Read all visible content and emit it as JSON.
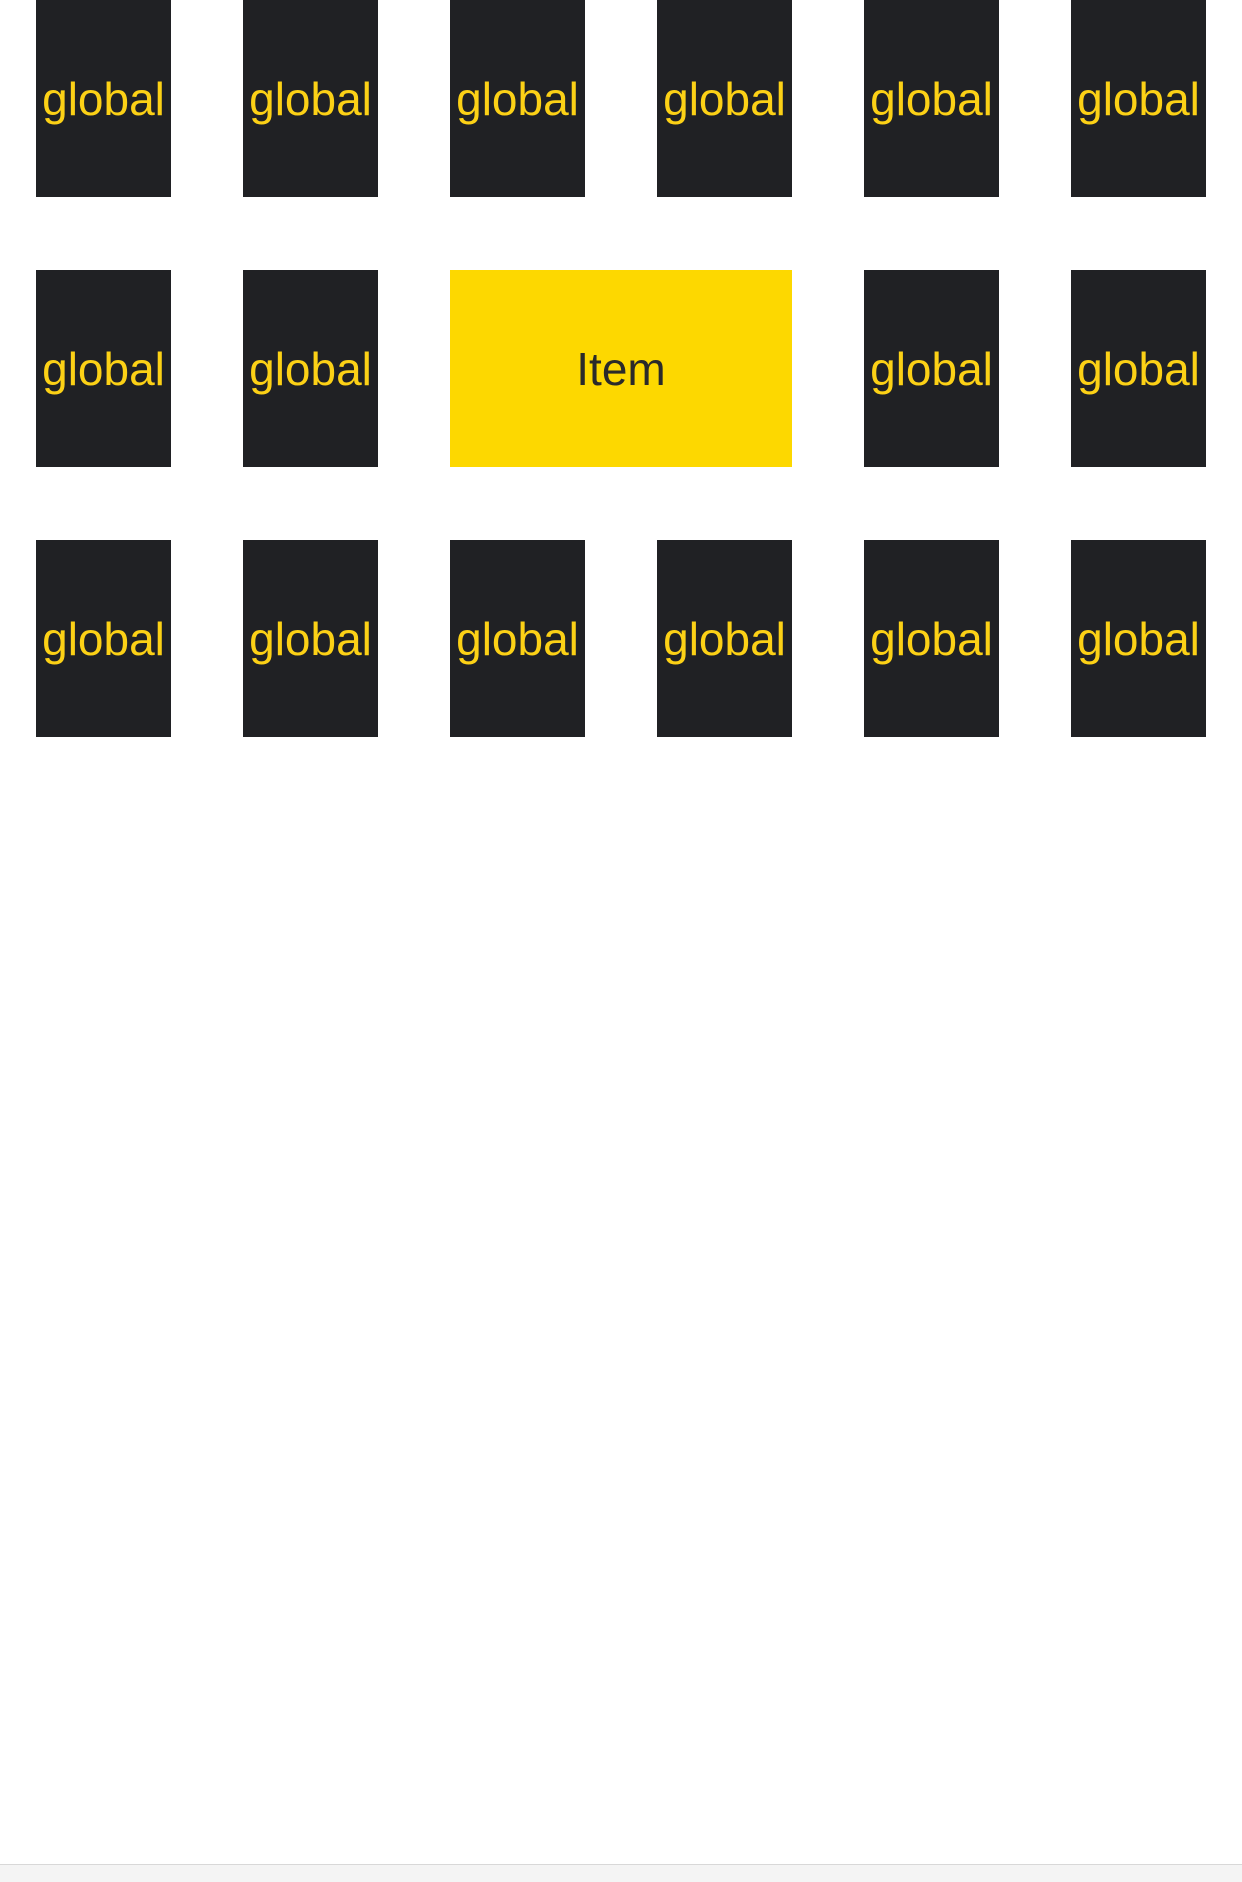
{
  "tiles": {
    "row1": [
      "global",
      "global",
      "global",
      "global",
      "global",
      "global"
    ],
    "row2": [
      "global",
      "global",
      "Item",
      "global",
      "global"
    ],
    "row3": [
      "global",
      "global",
      "global",
      "global",
      "global",
      "global"
    ]
  },
  "colors": {
    "tile_background": "#202124",
    "tile_text": "#fcd116",
    "highlight_background": "#fdd800",
    "highlight_text": "#2a2a2a"
  }
}
